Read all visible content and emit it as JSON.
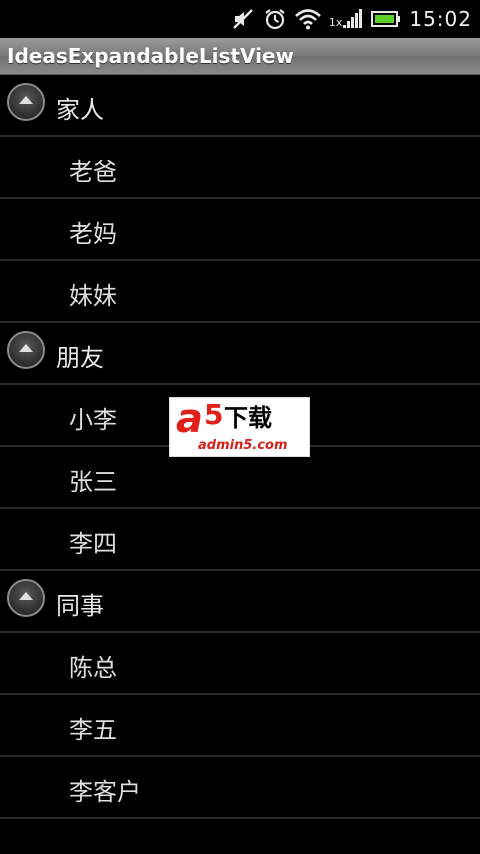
{
  "status_bar": {
    "time": "15:02",
    "network_label": "1x",
    "icons": [
      "mute-icon",
      "alarm-icon",
      "wifi-icon",
      "signal-icon",
      "battery-icon"
    ]
  },
  "app": {
    "title": "IdeasExpandableListView"
  },
  "groups": [
    {
      "label": "家人",
      "children": [
        "老爸",
        "老妈",
        "妹妹"
      ]
    },
    {
      "label": "朋友",
      "children": [
        "小李",
        "张三",
        "李四"
      ]
    },
    {
      "label": "同事",
      "children": [
        "陈总",
        "李五",
        "李客户"
      ]
    }
  ],
  "watermark": {
    "logo_a": "a",
    "logo_5": "5",
    "logo_text": "下载",
    "url": "admin5.com"
  },
  "colors": {
    "background": "#000000",
    "title_bar": "#7f7f7f",
    "divider": "#2a2a2a",
    "text": "#e6e6e6"
  }
}
